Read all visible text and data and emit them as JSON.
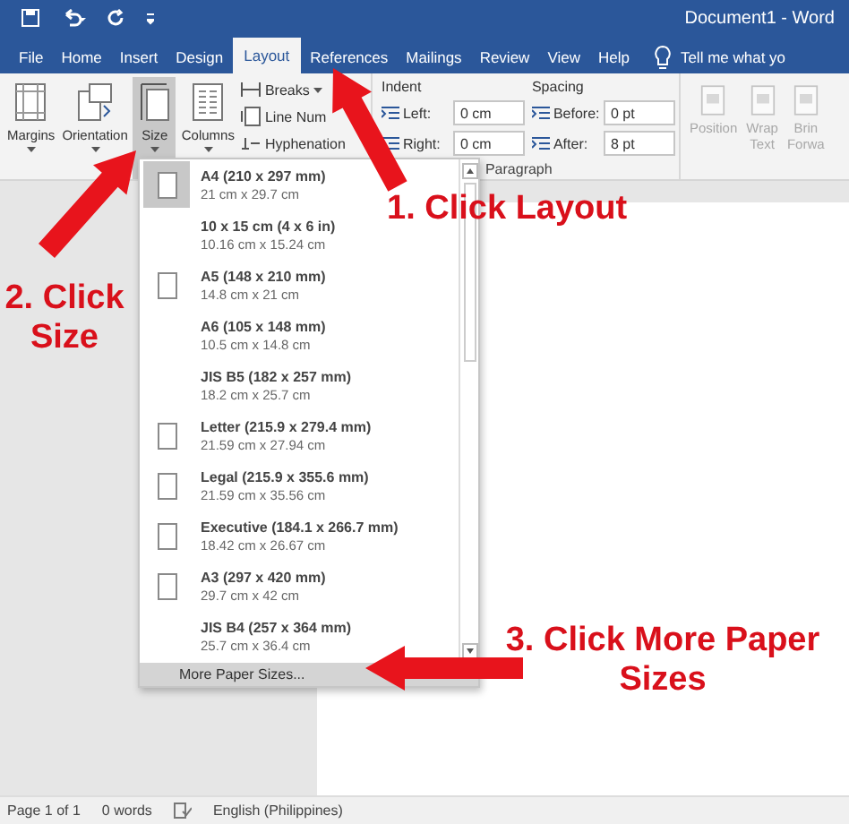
{
  "window": {
    "title": "Document1 - Word"
  },
  "tabs": [
    {
      "label": "File",
      "selected": false
    },
    {
      "label": "Home",
      "selected": false
    },
    {
      "label": "Insert",
      "selected": false
    },
    {
      "label": "Design",
      "selected": false
    },
    {
      "label": "Layout",
      "selected": true
    },
    {
      "label": "References",
      "selected": false
    },
    {
      "label": "Mailings",
      "selected": false
    },
    {
      "label": "Review",
      "selected": false
    },
    {
      "label": "View",
      "selected": false
    },
    {
      "label": "Help",
      "selected": false
    }
  ],
  "tell_me": "Tell me what yo",
  "page_setup": {
    "large_buttons": [
      {
        "label": "Margins",
        "kind": "margins",
        "selected": false
      },
      {
        "label": "Orientation",
        "kind": "orientation",
        "selected": false
      },
      {
        "label": "Size",
        "kind": "size",
        "selected": true
      },
      {
        "label": "Columns",
        "kind": "columns",
        "selected": false
      }
    ],
    "small_buttons": [
      {
        "label": "Breaks",
        "kind": "breaks"
      },
      {
        "label": "Line Num",
        "kind": "line-numbers"
      },
      {
        "label": "Hyphenation",
        "kind": "hyphenation"
      }
    ]
  },
  "paragraph": {
    "label": "Paragraph",
    "indent": {
      "label": "Indent",
      "fields": [
        {
          "label": "Left:",
          "value": "0 cm"
        },
        {
          "label": "Right:",
          "value": "0 cm"
        }
      ]
    },
    "spacing": {
      "label": "Spacing",
      "fields": [
        {
          "label": "Before:",
          "value": "0 pt"
        },
        {
          "label": "After:",
          "value": "8 pt"
        }
      ]
    }
  },
  "arrange": [
    {
      "lines": [
        "Position"
      ],
      "disabled": true
    },
    {
      "lines": [
        "Wrap",
        "Text"
      ],
      "disabled": true
    },
    {
      "lines": [
        "Brin",
        "Forwa"
      ],
      "disabled": true
    }
  ],
  "size_menu": {
    "items": [
      {
        "name": "A4 (210 x 297 mm)",
        "dims": "21 cm x 29.7 cm",
        "icon": true,
        "selected": true
      },
      {
        "name": "10 x 15 cm (4 x 6 in)",
        "dims": "10.16 cm x 15.24 cm",
        "icon": false,
        "selected": false
      },
      {
        "name": "A5 (148 x 210 mm)",
        "dims": "14.8 cm x 21 cm",
        "icon": true,
        "selected": false
      },
      {
        "name": "A6 (105 x 148 mm)",
        "dims": "10.5 cm x 14.8 cm",
        "icon": false,
        "selected": false
      },
      {
        "name": "JIS B5 (182 x 257 mm)",
        "dims": "18.2 cm x 25.7 cm",
        "icon": false,
        "selected": false
      },
      {
        "name": "Letter (215.9 x 279.4 mm)",
        "dims": "21.59 cm x 27.94 cm",
        "icon": true,
        "selected": false
      },
      {
        "name": "Legal (215.9 x 355.6 mm)",
        "dims": "21.59 cm x 35.56 cm",
        "icon": true,
        "selected": false
      },
      {
        "name": "Executive (184.1 x 266.7 mm)",
        "dims": "18.42 cm x 26.67 cm",
        "icon": true,
        "selected": false
      },
      {
        "name": "A3 (297 x 420 mm)",
        "dims": "29.7 cm x 42 cm",
        "icon": true,
        "selected": false
      },
      {
        "name": "JIS B4 (257 x 364 mm)",
        "dims": "25.7 cm x 36.4 cm",
        "icon": false,
        "selected": false
      }
    ],
    "footer": "More Paper Sizes..."
  },
  "annotations": [
    {
      "text": "1. Click Layout"
    },
    {
      "text": "2. Click Size"
    },
    {
      "text": "3. Click More Paper Sizes"
    }
  ],
  "status_bar": {
    "page": "Page 1 of 1",
    "words": "0 words",
    "language": "English (Philippines)"
  }
}
